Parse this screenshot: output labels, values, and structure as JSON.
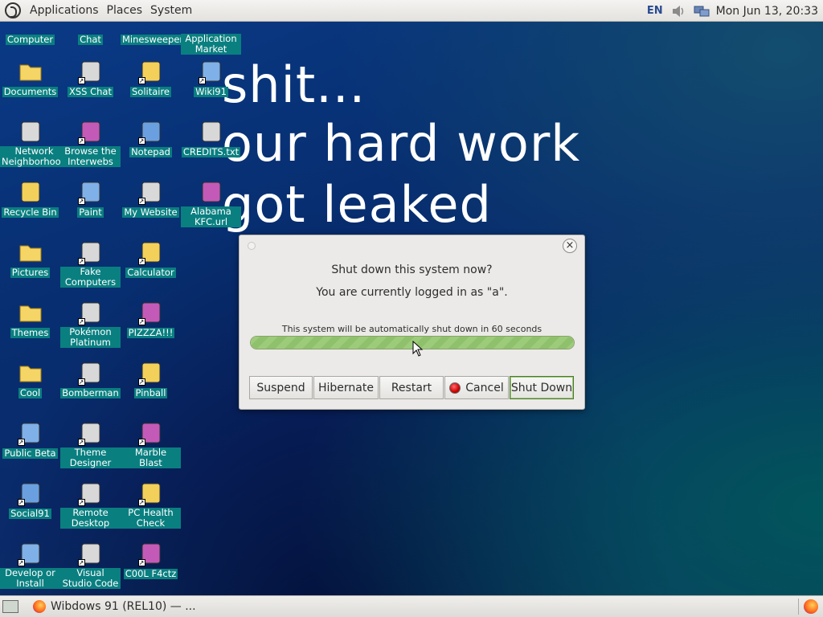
{
  "top_panel": {
    "menus": [
      "Applications",
      "Places",
      "System"
    ],
    "language": "EN",
    "clock": "Mon Jun 13, 20:33"
  },
  "wallpaper_text": [
    "shit...",
    "our hard work",
    "got leaked"
  ],
  "desktop_icons": [
    {
      "label": "Computer",
      "icon": "computer-icon"
    },
    {
      "label": "Chat",
      "icon": "chat-icon"
    },
    {
      "label": "Minesweeper",
      "icon": "minesweeper-icon"
    },
    {
      "label": "Application Market",
      "icon": "app-market-icon"
    },
    {
      "label": "Documents",
      "icon": "documents-folder-icon"
    },
    {
      "label": "XSS Chat",
      "icon": "xss-chat-icon"
    },
    {
      "label": "Solitaire",
      "icon": "solitaire-icon"
    },
    {
      "label": "Wiki91",
      "icon": "wiki-icon"
    },
    {
      "label": "Network Neighborhood",
      "icon": "network-icon"
    },
    {
      "label": "Browse the Interwebs",
      "icon": "browser-globe-icon"
    },
    {
      "label": "Notepad",
      "icon": "notepad-icon"
    },
    {
      "label": "CREDITS.txt",
      "icon": "text-file-icon"
    },
    {
      "label": "Recycle Bin",
      "icon": "recycle-bin-icon"
    },
    {
      "label": "Paint",
      "icon": "paint-icon"
    },
    {
      "label": "My Website",
      "icon": "website-icon"
    },
    {
      "label": "Alabama KFC.url",
      "icon": "url-file-icon"
    },
    {
      "label": "Pictures",
      "icon": "pictures-folder-icon"
    },
    {
      "label": "Fake Computers",
      "icon": "fake-computers-icon"
    },
    {
      "label": "Calculator",
      "icon": "calculator-icon"
    },
    {
      "label": "Themes",
      "icon": "themes-folder-icon"
    },
    {
      "label": "Pokémon Platinum",
      "icon": "pokemon-icon"
    },
    {
      "label": "PIZZZA!!!",
      "icon": "pizza-icon"
    },
    {
      "label": "Cool",
      "icon": "cool-folder-icon"
    },
    {
      "label": "Bomberman",
      "icon": "bomberman-icon"
    },
    {
      "label": "Pinball",
      "icon": "pinball-icon"
    },
    {
      "label": "Public Beta",
      "icon": "public-beta-icon"
    },
    {
      "label": "Theme Designer",
      "icon": "theme-designer-icon"
    },
    {
      "label": "Marble Blast",
      "icon": "marble-icon"
    },
    {
      "label": "Social91",
      "icon": "social-globe-icon"
    },
    {
      "label": "Remote Desktop",
      "icon": "remote-desktop-icon"
    },
    {
      "label": "PC Health Check",
      "icon": "health-check-icon"
    },
    {
      "label": "Develop or Install",
      "icon": "develop-icon"
    },
    {
      "label": "Visual Studio Code",
      "icon": "vscode-icon"
    },
    {
      "label": "C00L F4ctz",
      "icon": "facts-icon"
    }
  ],
  "dialog": {
    "title": "Shut down this system now?",
    "subtitle": "You are currently logged in as \"a\".",
    "countdown_text": "This system will be automatically shut down in 60 seconds",
    "progress_fraction": 1.0,
    "buttons": {
      "suspend": "Suspend",
      "hibernate": "Hibernate",
      "restart": "Restart",
      "cancel": "Cancel",
      "shutdown": "Shut Down"
    },
    "close_glyph": "×"
  },
  "taskbar": {
    "window_title": "Wibdows 91 (REL10) — ..."
  },
  "colors": {
    "icon_label_bg": "#0a7f80",
    "progress_green": "#9ccc7a"
  }
}
